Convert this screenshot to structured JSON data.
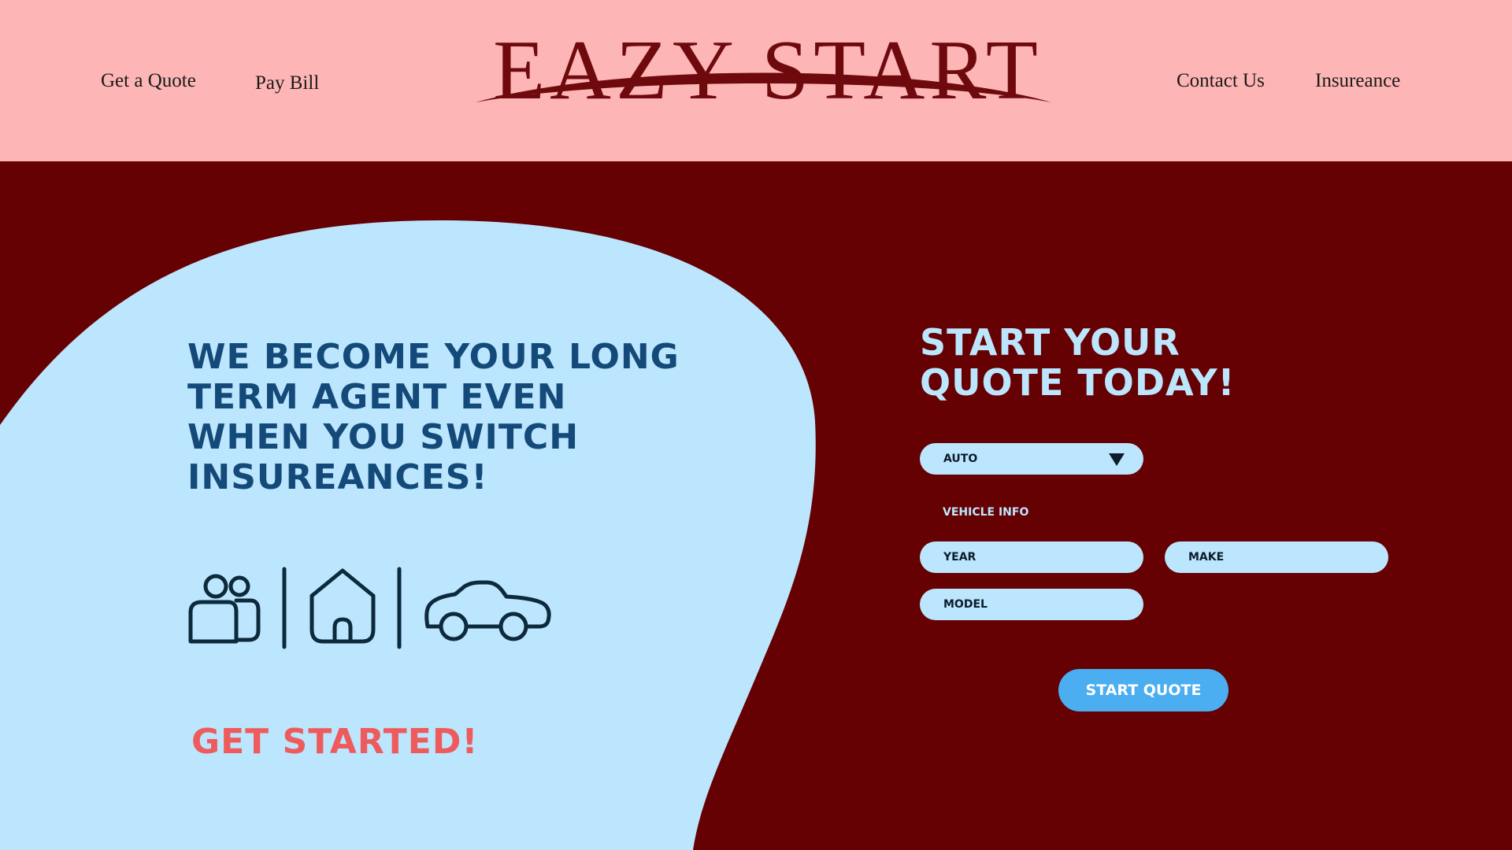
{
  "nav": {
    "left": [
      {
        "label": "Get a Quote"
      },
      {
        "label": "Pay Bill"
      }
    ],
    "right": [
      {
        "label": "Contact Us"
      },
      {
        "label": "Insureance"
      }
    ]
  },
  "brand": {
    "logo_text": "EAZY START"
  },
  "hero": {
    "headline": "WE BECOME YOUR LONG TERM AGENT EVEN WHEN YOU SWITCH INSUREANCES!",
    "cta": "GET STARTED!",
    "icons": [
      "family-icon",
      "house-icon",
      "car-icon"
    ]
  },
  "form": {
    "title": "START YOUR QUOTE TODAY!",
    "insurance_type": {
      "selected": "AUTO"
    },
    "section_label": "VEHICLE INFO",
    "fields": {
      "year": "YEAR",
      "make": "MAKE",
      "model": "MODEL"
    },
    "submit": "START QUOTE"
  },
  "colors": {
    "header_bg": "#feb5b5",
    "page_bg": "#650003",
    "blob": "#bce6fd",
    "headline": "#144a7a",
    "cta": "#ee5b5d",
    "button": "#4aaef0"
  }
}
